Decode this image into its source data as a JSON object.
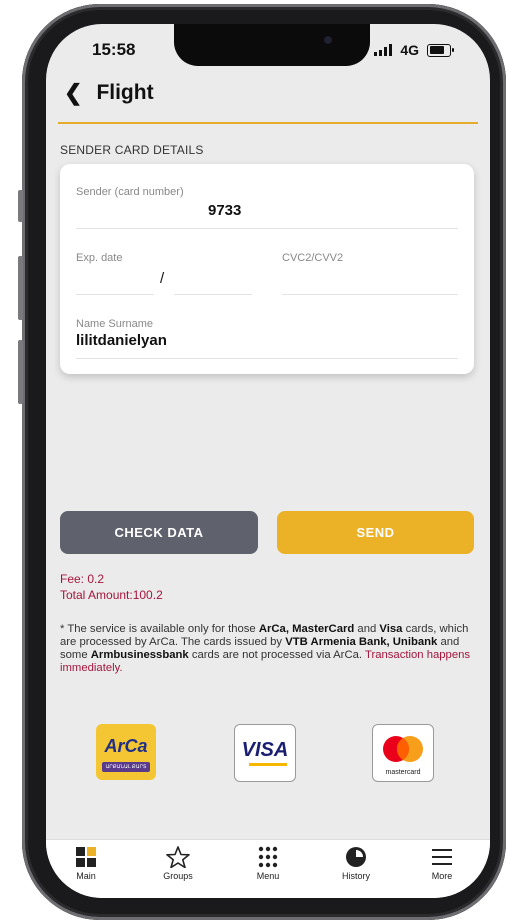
{
  "status_bar": {
    "time": "15:58",
    "network": "4G"
  },
  "header": {
    "title": "Flight"
  },
  "section_title": "SENDER CARD DETAILS",
  "form": {
    "card_number_label": "Sender (card number)",
    "card_number_value": "9733",
    "exp_date_label": "Exp. date",
    "exp_separator": "/",
    "cvc_label": "CVC2/CVV2",
    "name_label": "Name Surname",
    "name_value": "lilitdanielyan"
  },
  "buttons": {
    "check_data": "CHECK DATA",
    "send": "SEND"
  },
  "fee": {
    "fee_text": "Fee: 0.2",
    "total_text": "Total Amount:100.2"
  },
  "note": {
    "p1": "* The service is available only for those ",
    "arca": "ArCa, MasterCard",
    "p2": " and ",
    "visa": "Visa",
    "p3": " cards, which are processed by ArCa. The cards issued by ",
    "vtb": "VTB Armenia Bank, Unibank",
    "p4": " and some ",
    "arm": "Armbusinessbank",
    "p5": " cards are not processed via ArCa. ",
    "red": "Transaction happens immediately."
  },
  "logos": {
    "arca": "ArCa",
    "arca_sub": "ԱՐՔԱՆԱԼ ՔԱՐՏ",
    "visa": "VISA",
    "mastercard": "mastercard"
  },
  "tabs": [
    {
      "label": "Main",
      "icon": "grid-icon"
    },
    {
      "label": "Groups",
      "icon": "star-icon"
    },
    {
      "label": "Menu",
      "icon": "dots-grid-icon"
    },
    {
      "label": "History",
      "icon": "clock-icon"
    },
    {
      "label": "More",
      "icon": "hamburger-icon"
    }
  ],
  "colors": {
    "accent": "#ebb127",
    "fee_red": "#a3163d",
    "check_btn": "#5f626c"
  }
}
